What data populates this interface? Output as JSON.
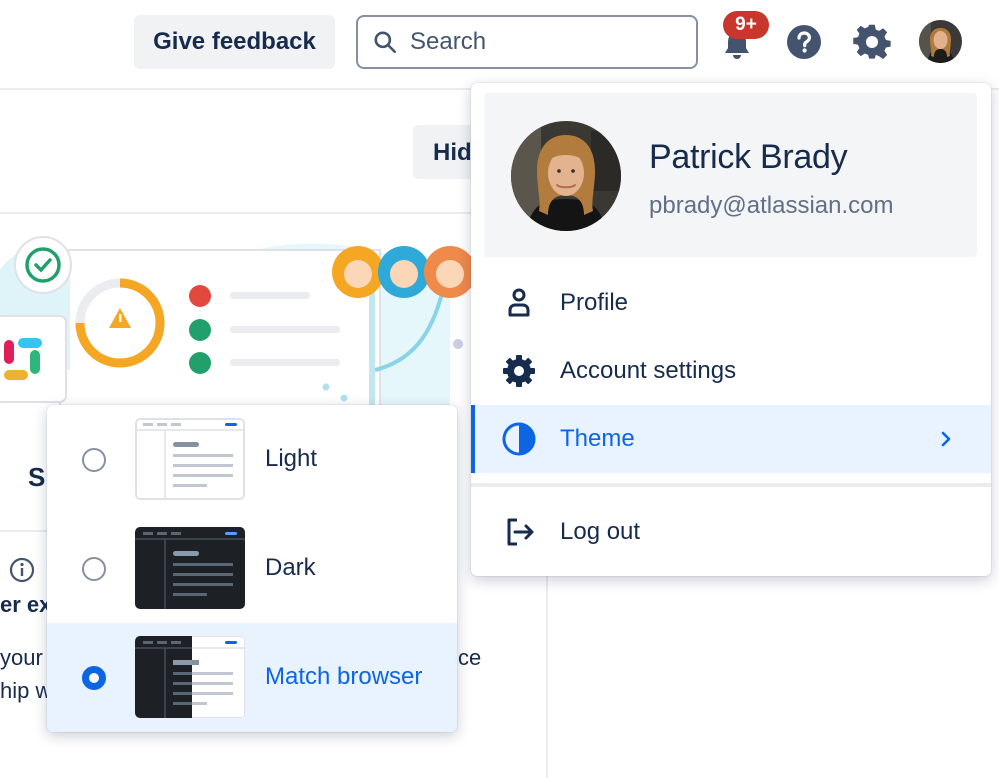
{
  "topbar": {
    "feedback_label": "Give feedback",
    "search_placeholder": "Search",
    "notification_badge": "9+",
    "icons": [
      "search-icon",
      "bell-icon",
      "help-icon",
      "gear-icon",
      "avatar"
    ]
  },
  "background": {
    "hide_button_label": "Hid",
    "section_letter": "S",
    "bold_text": "er ex",
    "text_line1": "your",
    "text_line2": "hip w",
    "text_line3": "ce"
  },
  "profile_menu": {
    "name": "Patrick Brady",
    "email": "pbrady@atlassian.com",
    "items": [
      {
        "label": "Profile",
        "icon": "person-icon"
      },
      {
        "label": "Account settings",
        "icon": "gear-icon"
      },
      {
        "label": "Theme",
        "icon": "half-circle-icon",
        "active": true
      },
      {
        "label": "Log out",
        "icon": "logout-icon"
      }
    ]
  },
  "theme_menu": {
    "options": [
      {
        "label": "Light",
        "selected": false
      },
      {
        "label": "Dark",
        "selected": false
      },
      {
        "label": "Match browser",
        "selected": true
      }
    ]
  },
  "colors": {
    "accent": "#0c66e4",
    "selected_bg": "#e9f2ff",
    "text": "#172b4d",
    "muted": "#626f86",
    "badge": "#c9372c"
  }
}
